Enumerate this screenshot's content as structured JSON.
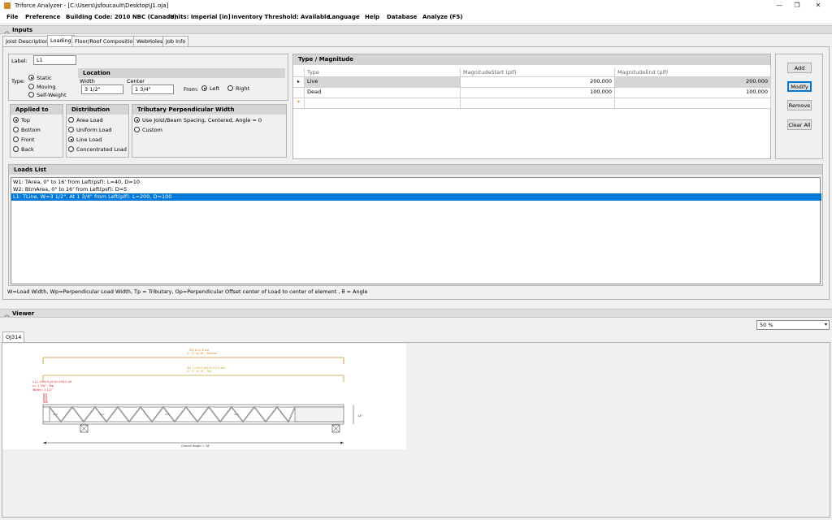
{
  "window": {
    "title": "Triforce Analyzer  - [C:\\Users\\jsfoucault\\Desktop\\J1.oja]",
    "minimize": "—",
    "maximize": "❐",
    "close": "✕"
  },
  "menu": [
    "File",
    "Preference",
    "Building Code:  2010 NBC (Canada)",
    "Units: Imperial [in]",
    "Inventory Threshold:  Available",
    "Language",
    "Help",
    "Database",
    "Analyze (F5)"
  ],
  "inputs_section": {
    "label": "Inputs",
    "collapse_icon": "chevron-up-icon"
  },
  "tabs": [
    "Joist Description",
    "Loading",
    "Floor/Roof Composition",
    "WebHoles",
    "Job Info"
  ],
  "active_tab": "Loading",
  "label_field": {
    "label": "Label:",
    "value": "L1"
  },
  "type_group": {
    "label": "Type:",
    "options": [
      "Static",
      "Moving",
      "Self-Weight"
    ],
    "selected": "Static"
  },
  "location": {
    "header": "Location",
    "width_label": "Width",
    "width_value": "3 1/2\"",
    "center_label": "Center",
    "center_value": "1 3/4\"",
    "from_label": "From:",
    "from_options": [
      "Left",
      "Right"
    ],
    "from_selected": "Left"
  },
  "applied_to": {
    "header": "Applied to",
    "options": [
      "Top",
      "Bottom",
      "Front",
      "Back"
    ],
    "selected": "Top"
  },
  "distribution": {
    "header": "Distribution",
    "options": [
      "Area Load",
      "Uniform Load",
      "Line Load",
      "Concentrated Load"
    ],
    "selected": "Line Load"
  },
  "tributary": {
    "header": "Tributary Perpendicular Width",
    "options": [
      "Use Joist/Beam Spacing, Centered, Angle = 0",
      "Custom"
    ],
    "selected": "Use Joist/Beam Spacing, Centered, Angle = 0"
  },
  "type_magnitude": {
    "header": "Type / Magnitude",
    "columns": [
      "Type",
      "MagnitudeStart (plf)",
      "MagnitudeEnd (plf)"
    ],
    "rows": [
      {
        "type": "Live",
        "start": "200.000",
        "end": "200.000"
      },
      {
        "type": "Dead",
        "start": "100.000",
        "end": "100.000"
      }
    ],
    "current_row_marker": "▸",
    "new_row_marker": "*"
  },
  "buttons": {
    "add": "Add",
    "modify": "Modify",
    "remove": "Remove",
    "clear_all": "Clear All"
  },
  "loads_list": {
    "header": "Loads List",
    "items": [
      "W1: TArea, 0\" to 16' from Left(psf): L=40, D=10",
      "W2: BtmArea, 0\" to 16' from Left(psf): D=5",
      "L1: TLine, W=3 1/2\", At 1 3/4\" from Left(plf): L=200, D=100"
    ],
    "selected_index": 2
  },
  "legend_note": "W=Load Width, Wp=Perpendicular Load Width, Tp = Tributary, Op=Perpendicular Offset center of Load to center of element , θ = Angle",
  "viewer_section": {
    "label": "Viewer",
    "collapse_icon": "chevron-up-icon"
  },
  "zoom": {
    "value": "50 %"
  },
  "viewer_tab": "OJ314",
  "drawing": {
    "w2_line1": "W2 D=5.0 psf",
    "w2_line2": "x= 0\" to 16' ; Bottom",
    "w1_line1": "W1 L=40.0 psf D=10.0 psf",
    "w1_line2": "x= 0\" to 16' ; Top",
    "l1_line1": "L1 L=200.0 plf D=100.0 plf",
    "l1_line2": "x= 1 3/4\" ; Top",
    "l1_line3": "Width= 3 1/2\"",
    "depth": "14\"",
    "overall": "Overall length = 16'",
    "web_label": "2x3",
    "colors": {
      "w2": "#d08a2a",
      "w1": "#c8a020",
      "l1": "#e02020",
      "joist": "#555555"
    }
  }
}
